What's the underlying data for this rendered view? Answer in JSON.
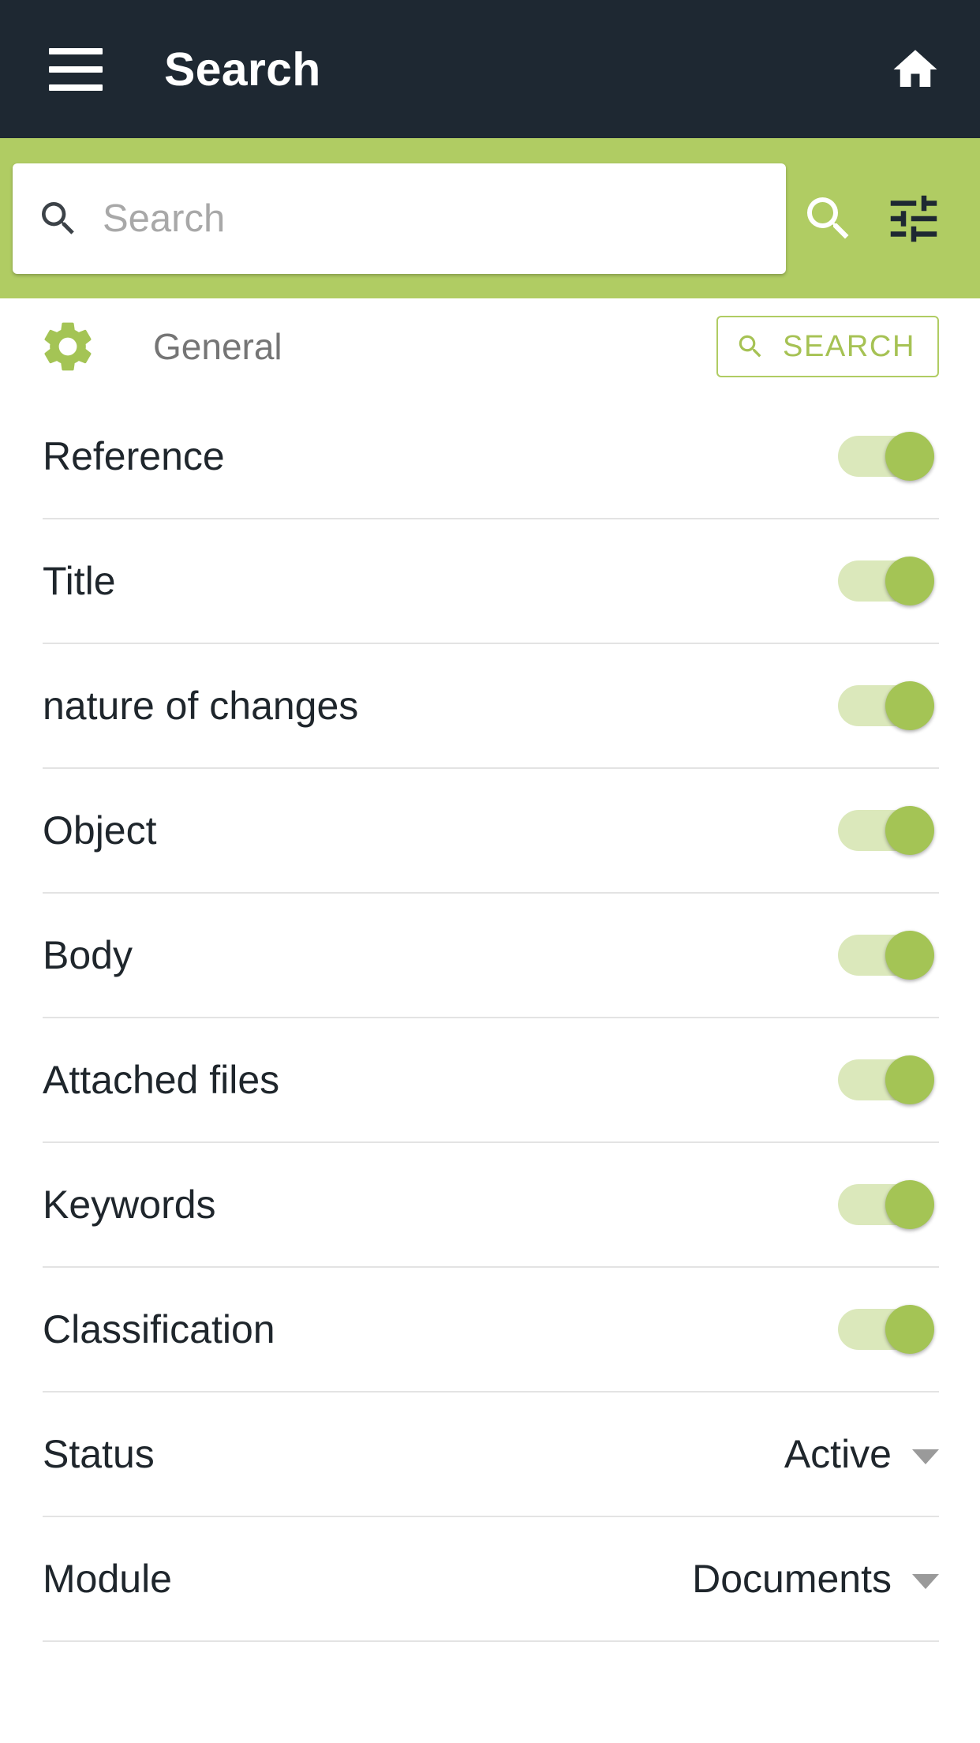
{
  "appbar": {
    "menu_icon": "hamburger-menu-icon",
    "title": "Search",
    "home_icon": "home-icon"
  },
  "search_strip": {
    "input_value": "",
    "placeholder": "Search",
    "leading_icon": "search-icon",
    "submit_icon": "search-icon",
    "filter_icon": "tune-sliders-icon",
    "background_color": "#b0cc63"
  },
  "section": {
    "icon": "gear-icon",
    "title": "General",
    "search_button": {
      "label": "SEARCH",
      "icon": "search-icon",
      "color": "#a6c254"
    }
  },
  "toggles": [
    {
      "label": "Reference",
      "state": "on"
    },
    {
      "label": "Title",
      "state": "on"
    },
    {
      "label": "nature of changes",
      "state": "on"
    },
    {
      "label": "Object",
      "state": "on"
    },
    {
      "label": "Body",
      "state": "on"
    },
    {
      "label": "Attached files",
      "state": "on"
    },
    {
      "label": "Keywords",
      "state": "on"
    },
    {
      "label": "Classification",
      "state": "on"
    }
  ],
  "selectors": [
    {
      "label": "Status",
      "value": "Active",
      "icon": "chevron-down-icon"
    },
    {
      "label": "Module",
      "value": "Documents",
      "icon": "chevron-down-icon"
    }
  ],
  "colors": {
    "appbar": "#1e2832",
    "accent_green": "#b0cc63",
    "toggle_track": "#dbe8bb",
    "toggle_thumb": "#a4c455",
    "divider": "#e3e3e3",
    "text_primary": "#1f262c",
    "text_muted": "#757575"
  }
}
